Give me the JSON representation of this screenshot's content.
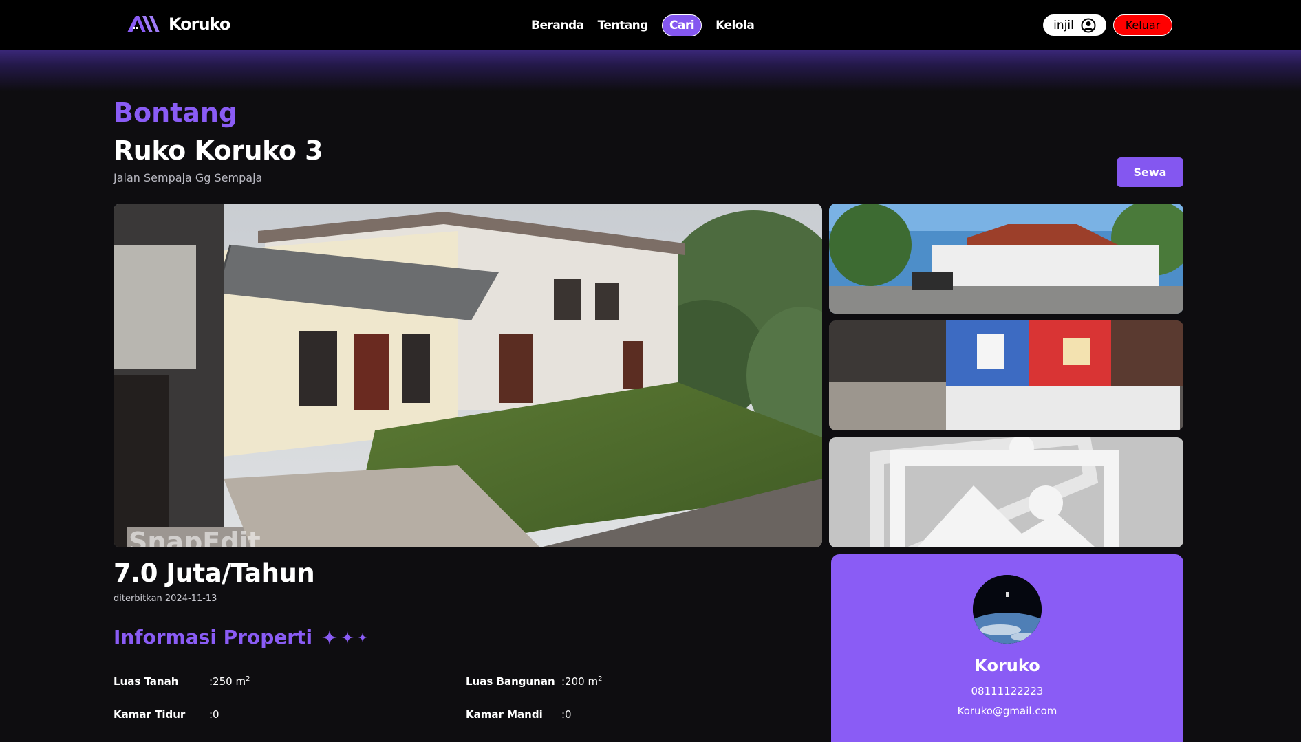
{
  "nav": {
    "logo_text": "Koruko",
    "links": [
      {
        "label": "Beranda"
      },
      {
        "label": "Tentang"
      },
      {
        "label": "Cari",
        "active": true
      },
      {
        "label": "Kelola"
      }
    ],
    "login_label": "injil",
    "logout_label": "Keluar"
  },
  "property": {
    "city": "Bontang",
    "title": "Ruko Koruko 3",
    "address": "Jalan Sempaja Gg Sempaja",
    "rent_button": "Sewa",
    "price": "7.0 Juta/Tahun",
    "published": "diterbitkan 2024-11-13",
    "main_photo_watermark": "SnapEdit"
  },
  "info": {
    "heading": "Informasi Properti",
    "specs": [
      {
        "label": "Luas Tanah",
        "value": ":250 m",
        "unit_sup": "2"
      },
      {
        "label": "Luas Bangunan",
        "value": ":200 m",
        "unit_sup": "2"
      },
      {
        "label": "Kamar Tidur",
        "value": ":0"
      },
      {
        "label": "Kamar Mandi",
        "value": ":0"
      }
    ]
  },
  "owner": {
    "name": "Koruko",
    "phone": "08111122223",
    "email": "Koruko@gmail.com"
  },
  "colors": {
    "accent": "#8a5cf5",
    "logout": "#ff0000",
    "background": "#0e0d10"
  }
}
